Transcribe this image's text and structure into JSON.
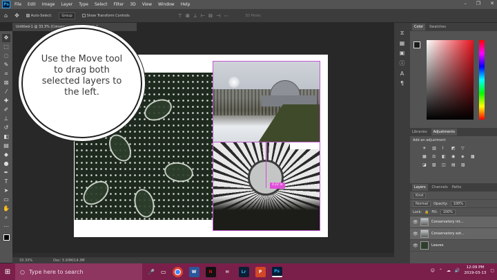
{
  "app": {
    "logo": "Ps",
    "menu": [
      "File",
      "Edit",
      "Image",
      "Layer",
      "Type",
      "Select",
      "Filter",
      "3D",
      "View",
      "Window",
      "Help"
    ],
    "window_controls": [
      "–",
      "❐",
      "✕"
    ]
  },
  "options_bar": {
    "auto_select_label": "Auto-Select:",
    "auto_select_value": "Group",
    "transform_controls_label": "Show Transform Controls",
    "mode_3d_label": "3D Mode:"
  },
  "document": {
    "tab_title": "Untitled-1 @ 33.3% (Conservatory int, RGB/8) *",
    "measure_label": "0.22 in"
  },
  "callout": {
    "text": "Use the Move tool to drag both selected layers to the left."
  },
  "status": {
    "zoom": "33.33%",
    "doc_size": "Doc: 5.93M/14.3M"
  },
  "right_panels": {
    "color_tabs": [
      "Color",
      "Swatches"
    ],
    "adjust_tabs": [
      "Libraries",
      "Adjustments"
    ],
    "adjust_caption": "Add an adjustment",
    "layers_tabs": [
      "Layers",
      "Channels",
      "Paths"
    ],
    "kind_label": "Kind",
    "blend_mode": "Normal",
    "opacity_label": "Opacity:",
    "opacity_value": "100%",
    "lock_label": "Lock:",
    "fill_label": "Fill:",
    "fill_value": "100%",
    "layers": [
      {
        "name": "Conservatory int..."
      },
      {
        "name": "Conservatory ext..."
      },
      {
        "name": "Leaves"
      }
    ]
  },
  "taskbar": {
    "search_placeholder": "Type here to search",
    "apps": [
      {
        "icon": "chrome-icon",
        "label": "",
        "color": "#ffffff"
      },
      {
        "icon": "word-icon",
        "label": "W",
        "color": "#2b579a"
      },
      {
        "icon": "netflix-icon",
        "label": "N",
        "color": "#111111"
      },
      {
        "icon": "mail-icon",
        "label": "✉",
        "color": "#7a1f4a"
      },
      {
        "icon": "lightroom-icon",
        "label": "Lr",
        "color": "#0a1f33"
      },
      {
        "icon": "powerpoint-icon",
        "label": "P",
        "color": "#d24726"
      },
      {
        "icon": "photoshop-icon",
        "label": "Ps",
        "color": "#001e36"
      }
    ],
    "time": "12:09 PM",
    "date": "2019-03-13"
  }
}
